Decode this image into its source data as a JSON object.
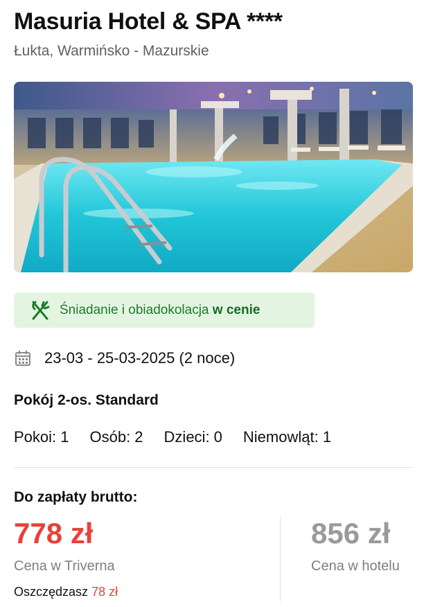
{
  "hotel": {
    "name": "Masuria Hotel & SPA ****",
    "location": "Łukta, Warmińsko - Mazurskie",
    "image_subject": "indoor-pool-photo"
  },
  "meals": {
    "icon": "fork-knife-icon",
    "text": "Śniadanie i obiadokolacja",
    "highlight": "w cenie",
    "color": "#1f7a2d",
    "background": "#e3f5e1"
  },
  "stay": {
    "icon": "calendar-icon",
    "dates": "23-03 - 25-03-2025 (2 noce)"
  },
  "room": {
    "name": "Pokój 2-os. Standard"
  },
  "occupancy": {
    "rooms": "Pokoi: 1",
    "persons": "Osób: 2",
    "children": "Dzieci: 0",
    "infants": "Niemowląt: 1"
  },
  "payment": {
    "label": "Do zapłaty brutto:",
    "triverna_price": "778 zł",
    "triverna_label": "Cena w Triverna",
    "savings_label": "Oszczędzasz",
    "savings_amount": "78 zł",
    "hotel_price": "856 zł",
    "hotel_label": "Cena w hotelu",
    "accent_color": "#e8413a"
  }
}
